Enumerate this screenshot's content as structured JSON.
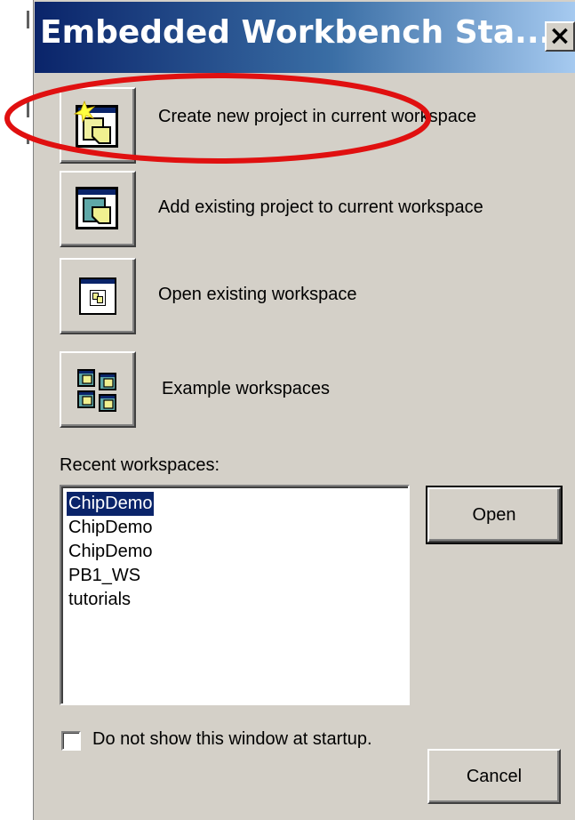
{
  "window": {
    "title": "Embedded Workbench Sta...",
    "close_glyph": "✕"
  },
  "actions": [
    {
      "icon": "new-project-icon",
      "label": "Create new project in current workspace"
    },
    {
      "icon": "add-project-icon",
      "label": "Add existing project to current workspace"
    },
    {
      "icon": "open-workspace-icon",
      "label": "Open existing workspace"
    },
    {
      "icon": "example-workspaces-icon",
      "label": "Example workspaces"
    }
  ],
  "recent": {
    "label": "Recent workspaces:",
    "items": [
      "ChipDemo",
      "ChipDemo",
      "ChipDemo",
      "PB1_WS",
      "tutorials"
    ],
    "selected_index": 0
  },
  "buttons": {
    "open_label": "Open",
    "cancel_label": "Cancel"
  },
  "startup": {
    "checkbox_label": "Do not show this window at startup.",
    "checked": false
  },
  "annotation": {
    "color": "#e01010"
  }
}
